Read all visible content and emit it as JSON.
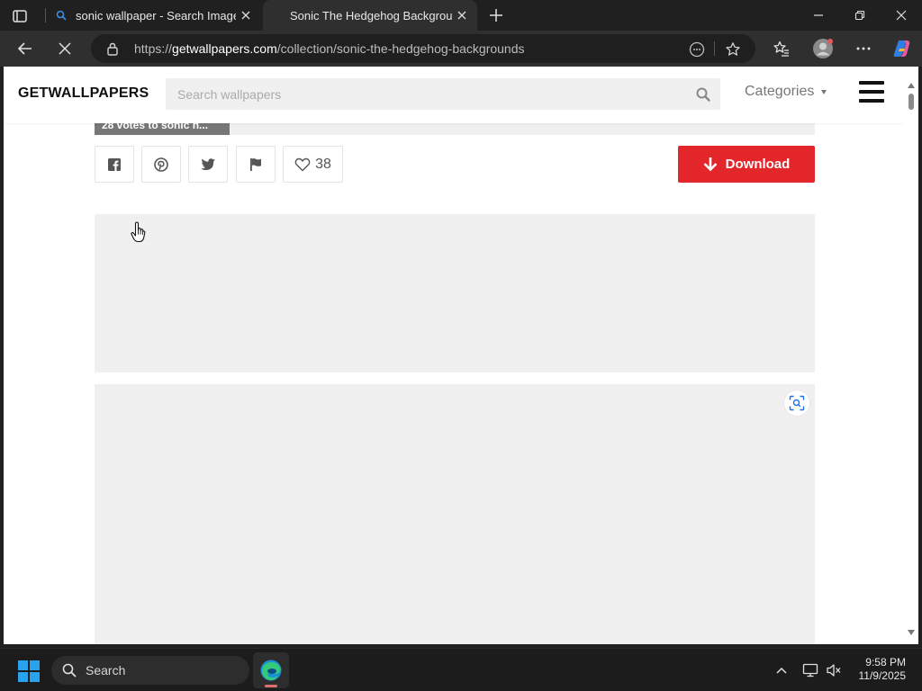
{
  "browser": {
    "tabs": [
      {
        "title": "sonic wallpaper - Search Images",
        "active": false
      },
      {
        "title": "Sonic The Hedgehog Backgrounds",
        "active": true
      }
    ],
    "url_prefix": "https://",
    "url_host": "getwallpapers.com",
    "url_path": "/collection/sonic-the-hedgehog-backgrounds"
  },
  "site": {
    "logo": "GETWALLPAPERS",
    "search_placeholder": "Search wallpapers",
    "categories_label": "Categories",
    "caption_fragment": "28 votes to sonic h...",
    "like_count": "38",
    "download_label": "Download",
    "brand_color": "#e3262a"
  },
  "taskbar": {
    "search_label": "Search",
    "time": "9:58 PM",
    "date": "11/9/2025"
  }
}
